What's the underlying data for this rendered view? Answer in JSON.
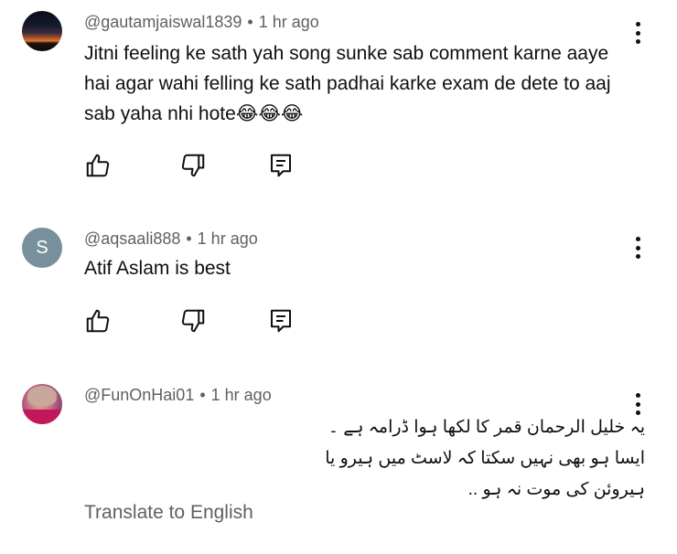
{
  "comments": [
    {
      "author": "@gautamjaiswal1839",
      "time": "1 hr ago",
      "text": "Jitni feeling ke sath yah song sunke sab comment karne aaye hai agar wahi felling ke sath padhai karke exam de dete to aaj sab yaha nhi hote😂😂😂",
      "avatar_icon": "sunset-avatar-icon"
    },
    {
      "author": "@aqsaali888",
      "time": "1 hr ago",
      "text": "Atif Aslam is best",
      "avatar_letter": "S",
      "avatar_color": "#78909c"
    },
    {
      "author": "@FunOnHai01",
      "time": "1 hr ago",
      "text": "یہ خلیل الرحمان قمر کا لکھا ہوا ڈرامہ ہے ۔ایسا ہو بھی نہیں سکتا کہ لاسٹ میں ہیرو یا ہیروئن کی موت نہ ہو ..",
      "translate_label": "Translate to English",
      "avatar_icon": "profile-photo-avatar-icon"
    }
  ],
  "separator": "•",
  "icons": [
    "like-icon",
    "dislike-icon",
    "reply-icon",
    "more-vert-icon"
  ]
}
